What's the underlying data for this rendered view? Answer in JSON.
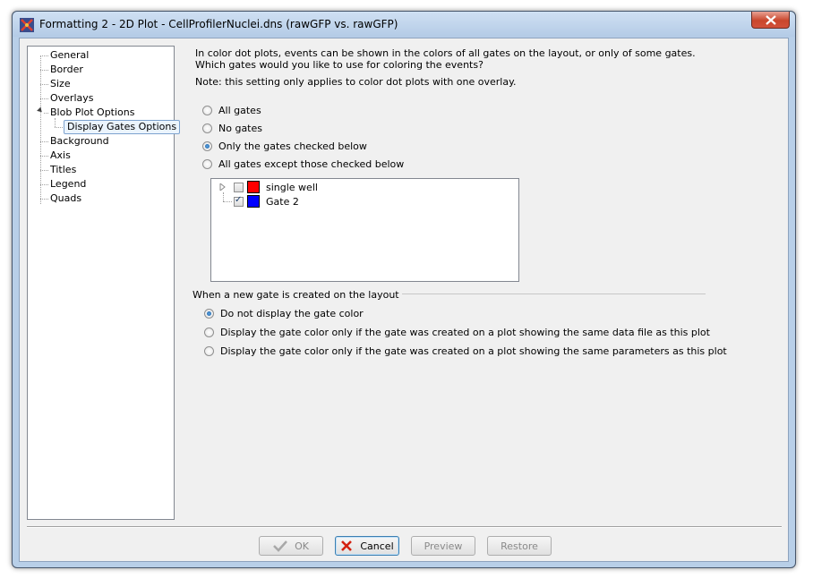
{
  "window": {
    "title": "Formatting 2 - 2D Plot - CellProfilerNuclei.dns (rawGFP vs. rawGFP)"
  },
  "tree": {
    "items": [
      {
        "label": "General"
      },
      {
        "label": "Border"
      },
      {
        "label": "Size"
      },
      {
        "label": "Overlays"
      },
      {
        "label": "Blob Plot Options"
      },
      {
        "label": "Display Gates Options"
      },
      {
        "label": "Background"
      },
      {
        "label": "Axis"
      },
      {
        "label": "Titles"
      },
      {
        "label": "Legend"
      },
      {
        "label": "Quads"
      }
    ]
  },
  "main": {
    "description": "In color dot plots, events can be shown in the colors of all gates on the layout, or only of some gates. Which gates would you like to use for coloring the events?",
    "note": "Note: this setting only applies to color dot plots with one overlay.",
    "gate_options": [
      {
        "label": "All gates",
        "checked": false
      },
      {
        "label": "No gates",
        "checked": false
      },
      {
        "label": "Only the gates checked below",
        "checked": true
      },
      {
        "label": "All gates except those checked below",
        "checked": false
      }
    ],
    "gates": [
      {
        "label": "single well",
        "checked": false,
        "color": "#ff0000"
      },
      {
        "label": "Gate 2",
        "checked": true,
        "color": "#0000ff"
      }
    ],
    "new_gate_group": {
      "label": "When a new gate is created on the layout",
      "options": [
        {
          "label": "Do not display the gate color",
          "checked": true
        },
        {
          "label": "Display the gate color only if the gate was created on a plot showing the same data file as this plot",
          "checked": false
        },
        {
          "label": "Display the gate color only if the gate was created on a plot showing the same parameters as this plot",
          "checked": false
        }
      ]
    }
  },
  "buttons": {
    "ok": "OK",
    "cancel": "Cancel",
    "preview": "Preview",
    "restore": "Restore"
  }
}
